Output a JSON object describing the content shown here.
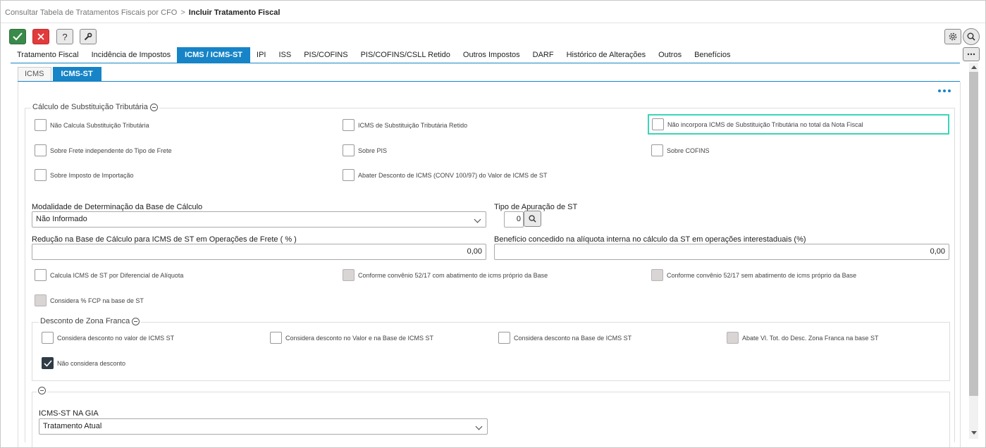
{
  "breadcrumb": {
    "parent": "Consultar Tabela de Tratamentos Fiscais por CFO",
    "separator": ">",
    "current": "Incluir Tratamento Fiscal"
  },
  "toolbar": {
    "confirm_icon": "check-icon",
    "cancel_icon": "close-icon",
    "help_label": "?",
    "tool_icon": "wrench-icon",
    "settings_icon": "gear-icon",
    "search_icon": "search-icon",
    "more_icon": "more-horizontal-icon"
  },
  "tabs": [
    {
      "label": "Tratamento Fiscal"
    },
    {
      "label": "Incidência de Impostos"
    },
    {
      "label": "ICMS / ICMS-ST",
      "active": true
    },
    {
      "label": "IPI"
    },
    {
      "label": "ISS"
    },
    {
      "label": "PIS/COFINS"
    },
    {
      "label": "PIS/COFINS/CSLL Retido"
    },
    {
      "label": "Outros Impostos"
    },
    {
      "label": "DARF"
    },
    {
      "label": "Histórico de Alterações"
    },
    {
      "label": "Outros"
    },
    {
      "label": "Benefícios"
    }
  ],
  "subtabs": [
    {
      "label": "ICMS"
    },
    {
      "label": "ICMS-ST",
      "active": true
    }
  ],
  "calc_st": {
    "title": "Cálculo de Substituição Tributária",
    "checks": [
      {
        "label": "Não Calcula Substituição Tributária",
        "state": "unchecked"
      },
      {
        "label": "ICMS de Substituição Tributária Retido",
        "state": "unchecked"
      },
      {
        "label": "Não incorpora ICMS de Substituição Tributária no total da Nota Fiscal",
        "state": "unchecked"
      },
      {
        "label": "Sobre Frete independente do Tipo de Frete",
        "state": "unchecked"
      },
      {
        "label": "Sobre PIS",
        "state": "unchecked"
      },
      {
        "label": "Sobre COFINS",
        "state": "unchecked"
      },
      {
        "label": "Sobre Imposto de Importação",
        "state": "unchecked"
      },
      {
        "label": "Abater Desconto de ICMS (CONV 100/97) do Valor de ICMS de ST",
        "state": "unchecked"
      }
    ],
    "modalidade_label": "Modalidade de Determinação da Base de Cálculo",
    "modalidade_value": "Não Informado",
    "tipo_label": "Tipo de Apuração de ST",
    "tipo_value": "0",
    "reducao_label": "Redução na Base de Cálculo para ICMS de ST em Operações de Frete ( % )",
    "reducao_value": "0,00",
    "beneficio_label": "Benefício concedido na alíquota interna no cálculo da ST em operações interestaduais (%)",
    "beneficio_value": "0,00",
    "checks2": [
      {
        "label": "Calcula ICMS de ST por Diferencial de Alíquota",
        "state": "unchecked"
      },
      {
        "label": "Conforme convênio 52/17 com abatimento de icms próprio da Base",
        "state": "disabled"
      },
      {
        "label": "Conforme convênio 52/17 sem abatimento de icms próprio da Base",
        "state": "disabled"
      },
      {
        "label": "Considera % FCP na base de ST",
        "state": "disabled"
      }
    ]
  },
  "zona_franca": {
    "title": "Desconto de Zona Franca",
    "checks": [
      {
        "label": "Considera desconto no valor de ICMS ST",
        "state": "unchecked"
      },
      {
        "label": "Considera desconto no Valor e na Base de ICMS ST",
        "state": "unchecked"
      },
      {
        "label": "Considera desconto na Base de ICMS ST",
        "state": "unchecked"
      },
      {
        "label": "Abate Vl. Tot. do Desc. Zona Franca na base ST",
        "state": "disabled"
      },
      {
        "label": "Não considera desconto",
        "state": "checked"
      }
    ]
  },
  "gia": {
    "label": "ICMS-ST NA GIA",
    "value": "Tratamento Atual"
  }
}
